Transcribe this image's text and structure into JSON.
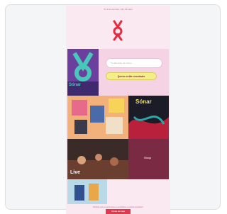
{
  "email": {
    "top_line": "Si no lo ves bien, haz clic aquí",
    "logo_name": "festival-logo",
    "newsletter": {
      "input_placeholder": "Tu dirección de correo",
      "button_label": "Quiero recibir novedades"
    },
    "tiles": {
      "t1_label": "Sónar",
      "t4_label": "Sónar",
      "t5_label": "Live",
      "t6_label": "Shop"
    },
    "footer_text": "Recibes este email porque te suscribiste a nuestra newsletter",
    "footer_button": "Darse de baja"
  },
  "colors": {
    "accent": "#e03a52",
    "background": "#fbe9f1"
  }
}
